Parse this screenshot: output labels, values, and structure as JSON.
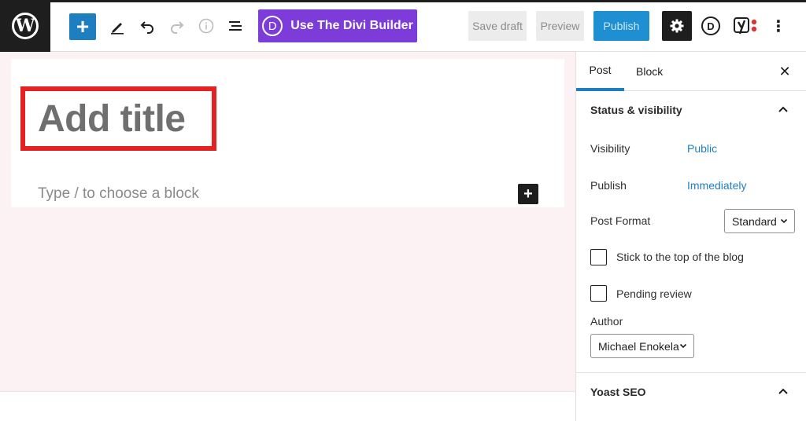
{
  "toolbar": {
    "add_block": "+",
    "divi_button": "Use The Divi Builder",
    "divi_letter": "D",
    "save_draft": "Save draft",
    "preview": "Preview",
    "publish": "Publish",
    "more": "⋮",
    "icons": [
      "wordpress-logo",
      "plus",
      "pencil",
      "undo",
      "redo",
      "info",
      "list-view",
      "divi-d",
      "gear",
      "yoast",
      "more-vertical"
    ]
  },
  "editor": {
    "title_placeholder": "Add title",
    "block_placeholder": "Type / to choose a block",
    "inline_add": "+"
  },
  "sidebar": {
    "tabs": [
      {
        "label": "Post",
        "active": true
      },
      {
        "label": "Block",
        "active": false
      }
    ],
    "close": "✕",
    "status_panel": {
      "title": "Status & visibility",
      "visibility_label": "Visibility",
      "visibility_value": "Public",
      "publish_label": "Publish",
      "publish_value": "Immediately",
      "format_label": "Post Format",
      "format_value": "Standard",
      "sticky_label": "Stick to the top of the blog",
      "sticky_checked": false,
      "pending_label": "Pending review",
      "pending_checked": false,
      "author_label": "Author",
      "author_value": "Michael Enokela"
    },
    "yoast_panel": {
      "title": "Yoast SEO"
    }
  },
  "colors": {
    "accent": "#1e7fc0",
    "divi": "#7d3bd9",
    "highlight": "#e52121",
    "editor_bg": "#fdf2f3",
    "dark": "#1e1e1e"
  }
}
